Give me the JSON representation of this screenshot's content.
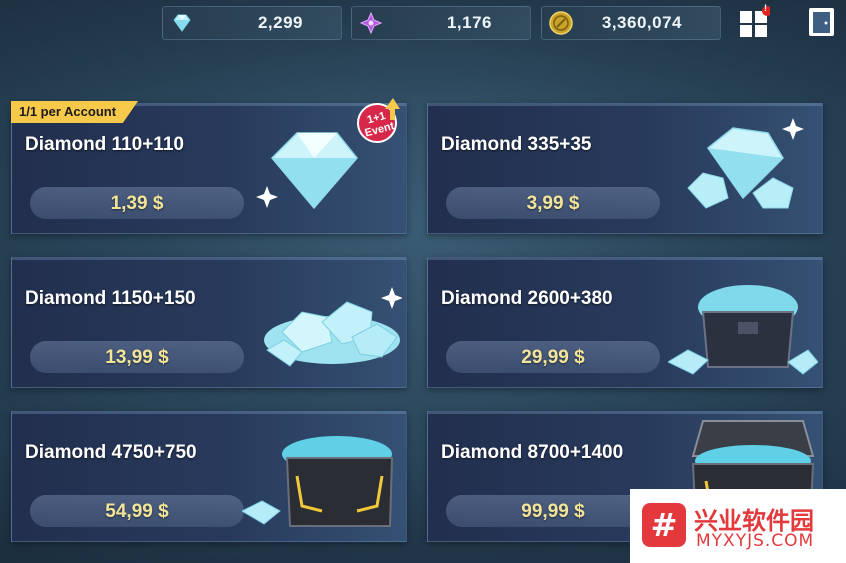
{
  "currencies": {
    "diamond": {
      "value": "2,299",
      "icon": "diamond-icon"
    },
    "crystal": {
      "value": "1,176",
      "icon": "purple-crystal-icon"
    },
    "gold": {
      "value": "3,360,074",
      "icon": "gold-coin-icon"
    }
  },
  "top_buttons": {
    "menu_badge": "!",
    "menu_icon": "grid-menu-icon",
    "exit_icon": "exit-door-icon"
  },
  "products": [
    {
      "title": "Diamond 110+110",
      "price": "1,39 $",
      "tag": "1/1 per Account",
      "event": "1+1 Event"
    },
    {
      "title": "Diamond 335+35",
      "price": "3,99 $"
    },
    {
      "title": "Diamond 1150+150",
      "price": "13,99 $"
    },
    {
      "title": "Diamond 2600+380",
      "price": "29,99 $"
    },
    {
      "title": "Diamond 4750+750",
      "price": "54,99 $"
    },
    {
      "title": "Diamond 8700+1400",
      "price": "99,99 $"
    }
  ],
  "watermark": {
    "logo_glyph": "#",
    "name": "兴业软件园",
    "url": "MYXYJS.COM"
  },
  "colors": {
    "price_text": "#f2e59a",
    "tag_bg": "#f6c94a",
    "event_badge": "#d8284a",
    "watermark_red": "#e4393c"
  }
}
